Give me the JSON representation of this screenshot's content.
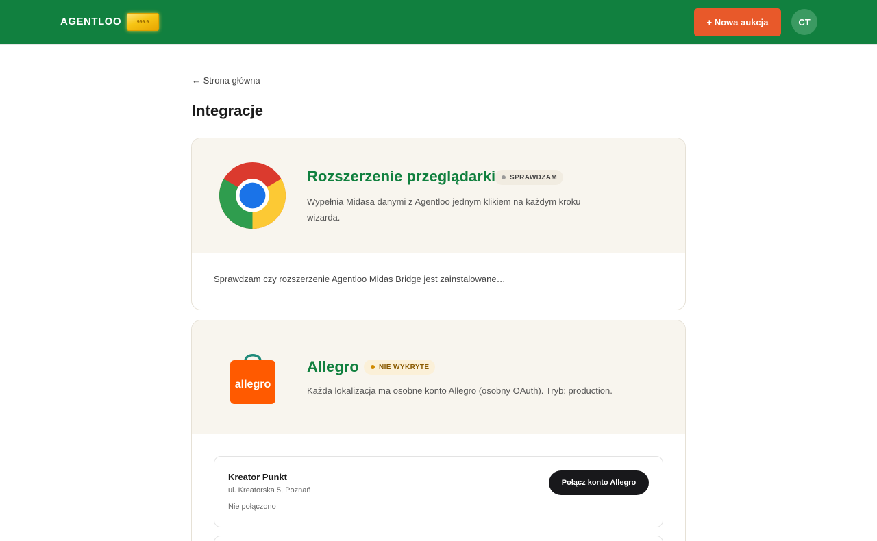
{
  "header": {
    "brand": "AGENTLOO",
    "gold_bar_label": "999.9",
    "new_auction_label": "+ Nowa aukcja",
    "avatar_initials": "CT",
    "bg_color": "#11803f",
    "accent_color": "#e8592a"
  },
  "nav": {
    "back_label": "← Strona główna"
  },
  "page": {
    "title": "Integracje"
  },
  "integrations": [
    {
      "icon": "chrome-logo-icon",
      "title": "Rozszerzenie przeglądarki",
      "badge": "SPRAWDZAM",
      "description": "Wypełnia Midasa danymi z Agentloo jednym klikiem na każdym kroku wizarda.",
      "body_text": "Sprawdzam czy rozszerzenie Agentloo Midas Bridge jest zainstalowane…"
    },
    {
      "icon": "allegro-logo-icon",
      "title": "Allegro",
      "badge": "NIE WYKRYTE",
      "logo_text": "allegro",
      "description": "Każda lokalizacja ma osobne konto Allegro (osobny OAuth). Tryb: production.",
      "locations": [
        {
          "name": "Kreator Punkt",
          "address": "ul. Kreatorska 5, Poznań",
          "status": "Nie połączono",
          "action_label": "Połącz konto Allegro"
        }
      ]
    }
  ]
}
